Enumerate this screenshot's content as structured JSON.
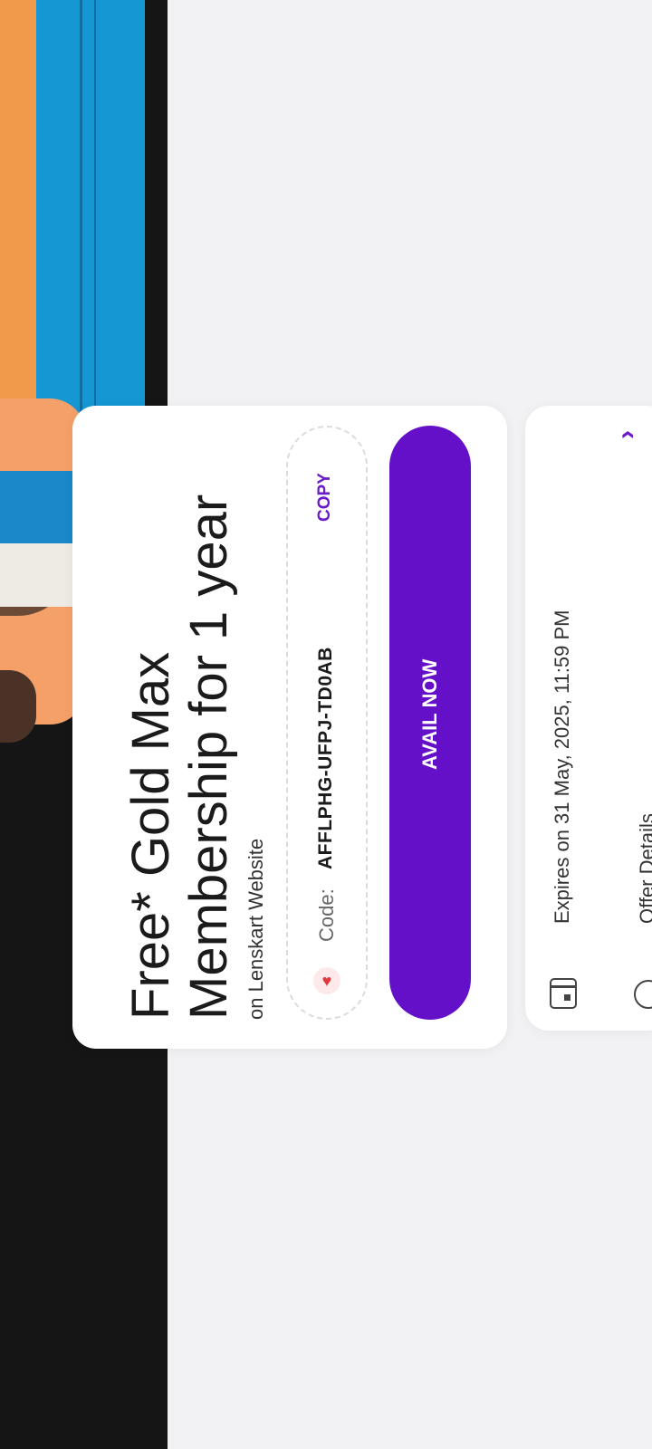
{
  "offer": {
    "title_line1": "Free* Gold Max",
    "title_line2": "Membership for 1 year",
    "subtitle": "on Lenskart Website",
    "code_label": "Code:",
    "code_value": "AFFLPHG-UFPJ-TD0AB",
    "copy_label": "COPY",
    "avail_label": "AVAIL NOW"
  },
  "details": {
    "expiry": "Expires on 31 May, 2025, 11:59 PM",
    "offer_details_label": "Offer Details"
  },
  "icons": {
    "heart": "heart-icon",
    "calendar": "calendar-icon",
    "info": "info-icon",
    "chevron": "chevron-icon"
  },
  "colors": {
    "accent": "#6410c8",
    "copy_text": "#6a1ac7",
    "heart": "#e0383d"
  }
}
